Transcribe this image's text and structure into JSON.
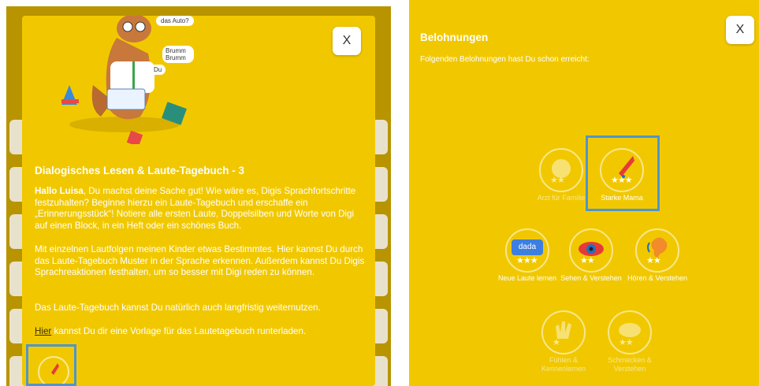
{
  "left": {
    "speech": {
      "top": "das Auto?",
      "middle": "Brumm Brumm",
      "bottom": "Du"
    },
    "close_label": "X",
    "title": "Dialogisches Lesen & Laute-Tagebuch - 3",
    "p1_name": "Hallo Luisa",
    "p1_text": ", Du machst deine Sache gut! Wie wäre es, Digis Sprachfortschritte festzuhalten? Beginne hierzu ein Laute-Tagebuch und erschaffe ein „Erinnerungsstück“! Notiere alle ersten Laute, Doppelsilben und Worte von Digi auf einen Block, in ein Heft oder ein schönes Buch.",
    "p2": "Mit einzelnen Lautfolgen meinen Kinder etwas Bestimmtes. Hier kannst Du durch das Laute-Tagebuch Muster in der Sprache erkennen. Außerdem kannst Du Digis Sprachreaktionen festhalten, um so besser mit Digi reden zu können.",
    "p3": "Das Laute-Tagebuch kannst Du natürlich auch langfristig weiternutzen.",
    "p4_link": "Hier",
    "p4_text": " kannst Du dir eine Vorlage für das Lautetagebuch runterladen."
  },
  "right": {
    "close_label": "X",
    "title": "Belohnungen",
    "subtitle": "Folgenden Belohnungen hast Du schon erreicht:",
    "badges": [
      {
        "label": "Arzt für Familie",
        "icon": "stethoscope-icon",
        "earned": false
      },
      {
        "label": "Starke Mama",
        "icon": "rocket-icon",
        "earned": true
      },
      {
        "label": "Neue Laute lernen",
        "icon": "dada-card-icon",
        "earned": true
      },
      {
        "label": "Sehen & Verstehen",
        "icon": "eye-icon",
        "earned": true
      },
      {
        "label": "Hören & Verstehen",
        "icon": "ear-icon",
        "earned": true
      },
      {
        "label": "Fühlen & Kennenlernen",
        "icon": "hand-icon",
        "earned": false
      },
      {
        "label": "Schmecken & Verstehen",
        "icon": "lips-icon",
        "earned": false
      }
    ]
  },
  "colors": {
    "modal_bg": "#f1c800",
    "highlight": "#4f95cc",
    "rocket": "#e63a3a"
  }
}
